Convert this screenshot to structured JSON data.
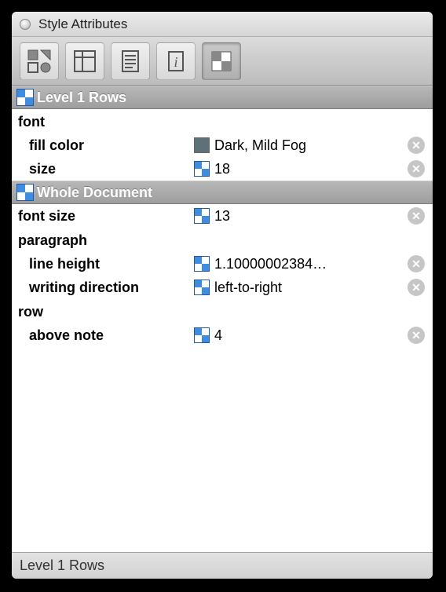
{
  "window": {
    "title": "Style Attributes"
  },
  "toolbar": {
    "buttons": [
      {
        "name": "layout",
        "selected": false
      },
      {
        "name": "columns",
        "selected": false
      },
      {
        "name": "page",
        "selected": false
      },
      {
        "name": "info",
        "selected": false
      },
      {
        "name": "styles",
        "selected": true
      }
    ]
  },
  "sections": [
    {
      "title": "Level 1 Rows",
      "groups": [
        {
          "label": "font",
          "attrs": [
            {
              "name": "fill color",
              "value": "Dark, Mild Fog",
              "swatch_type": "color",
              "swatch_color": "#5f7178"
            },
            {
              "name": "size",
              "value": "18",
              "swatch_type": "checker"
            }
          ]
        }
      ]
    },
    {
      "title": "Whole Document",
      "groups": [
        {
          "label": null,
          "attrs": [
            {
              "name": "font size",
              "value": "13",
              "swatch_type": "checker",
              "top": true
            }
          ]
        },
        {
          "label": "paragraph",
          "attrs": [
            {
              "name": "line height",
              "value": "1.10000002384…",
              "swatch_type": "checker"
            },
            {
              "name": "writing direction",
              "value": "left-to-right",
              "swatch_type": "checker"
            }
          ]
        },
        {
          "label": "row",
          "attrs": [
            {
              "name": "above note",
              "value": "4",
              "swatch_type": "checker"
            }
          ]
        }
      ]
    }
  ],
  "statusbar": {
    "text": "Level 1 Rows"
  }
}
